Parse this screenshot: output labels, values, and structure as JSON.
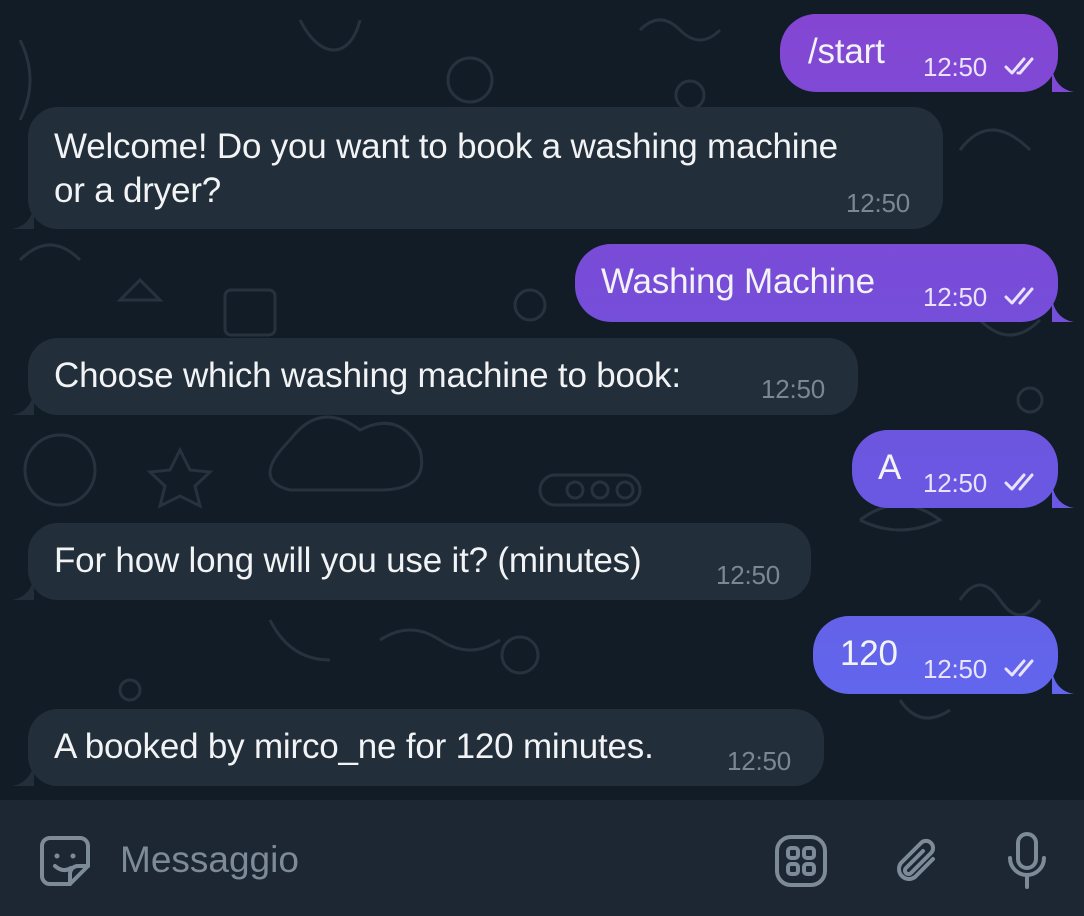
{
  "messages": [
    {
      "direction": "outgoing",
      "text": "/start",
      "time": "12:50",
      "status": "read"
    },
    {
      "direction": "incoming",
      "text_lines": [
        "Welcome! Do you want to book a washing machine",
        "or a dryer?"
      ],
      "time": "12:50"
    },
    {
      "direction": "outgoing",
      "text": "Washing Machine",
      "time": "12:50",
      "status": "read"
    },
    {
      "direction": "incoming",
      "text": "Choose which washing machine to book:",
      "time": "12:50"
    },
    {
      "direction": "outgoing",
      "text": "A",
      "time": "12:50",
      "status": "read"
    },
    {
      "direction": "incoming",
      "text": "For how long will you use it? (minutes)",
      "time": "12:50"
    },
    {
      "direction": "outgoing",
      "text": "120",
      "time": "12:50",
      "status": "read"
    },
    {
      "direction": "incoming",
      "text": "A booked by mirco_ne for 120 minutes.",
      "time": "12:50"
    }
  ],
  "composer": {
    "placeholder": "Messaggio",
    "icons": [
      "sticker-emoji-icon",
      "bot-commands-icon",
      "attach-icon",
      "microphone-icon"
    ]
  },
  "colors": {
    "chat_background": "#121c27",
    "incoming_bubble": "#222e39",
    "outgoing_gradient_top": "#8446d2",
    "outgoing_gradient_bottom": "#6166ec",
    "composer_background": "#1d2733",
    "placeholder_text": "#7d8b99"
  }
}
